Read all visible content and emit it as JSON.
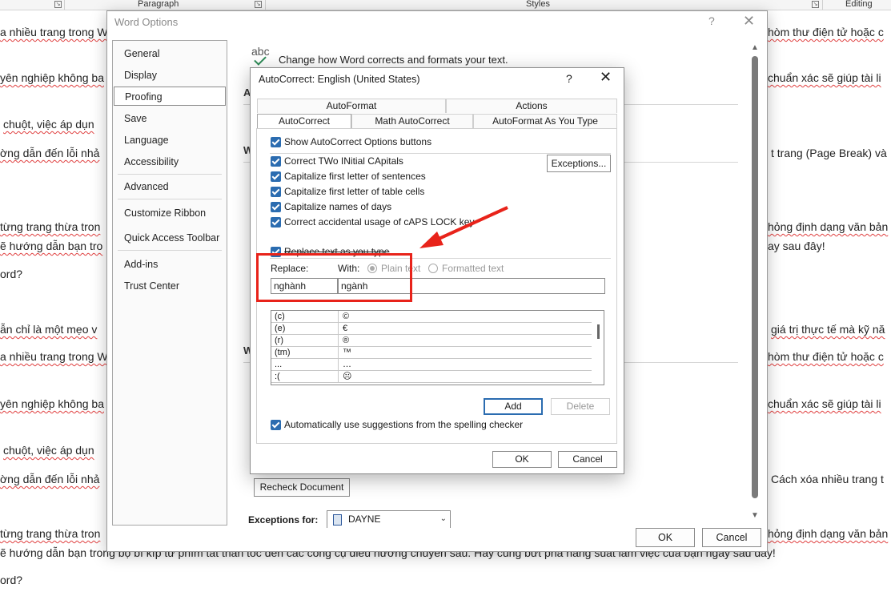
{
  "ribbon": {
    "groups": [
      "Paragraph",
      "Styles",
      "Editing"
    ]
  },
  "document": {
    "lines": [
      "a nhiều trang trong W",
      "yên nghiệp không ba",
      "chuột, việc áp dụn",
      "ờng dẫn đến lỗi nhả",
      "từng trang thừa tron",
      "ẽ hướng dẫn bạn tro",
      "ord?",
      "ẫn chỉ là một mẹo v",
      "a nhiều trang trong W",
      "yên nghiệp không ba",
      "chuột, việc áp dụn",
      "ờng dẫn đến lỗi nhả",
      "từng trang thừa tron",
      "ẽ hướng dẫn bạn trong bộ bí kíp từ phím tắt thần tốc đến các công cụ điều hướng chuyên sâu. Hãy cùng bứt phá năng suất làm việc của bạn ngay sau đây!",
      "ord?"
    ],
    "right_lines": [
      "hòm thư điện tử hoặc c",
      "chuẩn xác sẽ giúp tài li",
      "t trang (Page Break) và",
      "hỏng định dạng văn bản",
      "ay sau đây!",
      "giá trị thực tế mà kỹ nă",
      "hòm thư điện tử hoặc c",
      "chuẩn xác sẽ giúp tài li",
      "Cách xóa nhiều trang t",
      "hỏng định dạng văn bản"
    ]
  },
  "word_options": {
    "title": "Word Options",
    "help": "?",
    "close": "✕",
    "nav": [
      "General",
      "Display",
      "Proofing",
      "Save",
      "Language",
      "Accessibility",
      "Advanced",
      "Customize Ribbon",
      "Quick Access Toolbar",
      "Add-ins",
      "Trust Center"
    ],
    "selected_nav": "Proofing",
    "abc_icon": "abc",
    "change_text": "Change how Word corrects and formats your text.",
    "section_fragments": [
      "A",
      "W",
      "W"
    ],
    "recheck_label": "Recheck Document",
    "exceptions_label": "Exceptions for:",
    "exceptions_value": "DAYNE",
    "ok": "OK",
    "cancel": "Cancel"
  },
  "autocorrect": {
    "title": "AutoCorrect: English (United States)",
    "help": "?",
    "close": "✕",
    "tabs_row1": [
      "AutoFormat",
      "Actions"
    ],
    "tabs_row2": [
      "AutoCorrect",
      "Math AutoCorrect",
      "AutoFormat As You Type"
    ],
    "show_buttons": "Show AutoCorrect Options buttons",
    "options": [
      "Correct TWo INitial CApitals",
      "Capitalize first letter of sentences",
      "Capitalize first letter of table cells",
      "Capitalize names of days",
      "Correct accidental usage of cAPS LOCK key"
    ],
    "exceptions_btn": "Exceptions...",
    "replace_as_type": "Replace text as you type",
    "replace_label": "Replace:",
    "with_label": "With:",
    "plain_text": "Plain text",
    "formatted_text": "Formatted text",
    "replace_value": "nghành",
    "with_value": "ngành",
    "entries": [
      {
        "k": "(c)",
        "v": "©"
      },
      {
        "k": "(e)",
        "v": "€"
      },
      {
        "k": "(r)",
        "v": "®"
      },
      {
        "k": "(tm)",
        "v": "™"
      },
      {
        "k": "...",
        "v": "…"
      },
      {
        "k": ":(",
        "v": "☹"
      }
    ],
    "add": "Add",
    "delete": "Delete",
    "auto_suggest": "Automatically use suggestions from the spelling checker",
    "ok": "OK",
    "cancel": "Cancel"
  },
  "colors": {
    "accent": "#2b6cb0",
    "annotation": "#e8231a"
  }
}
